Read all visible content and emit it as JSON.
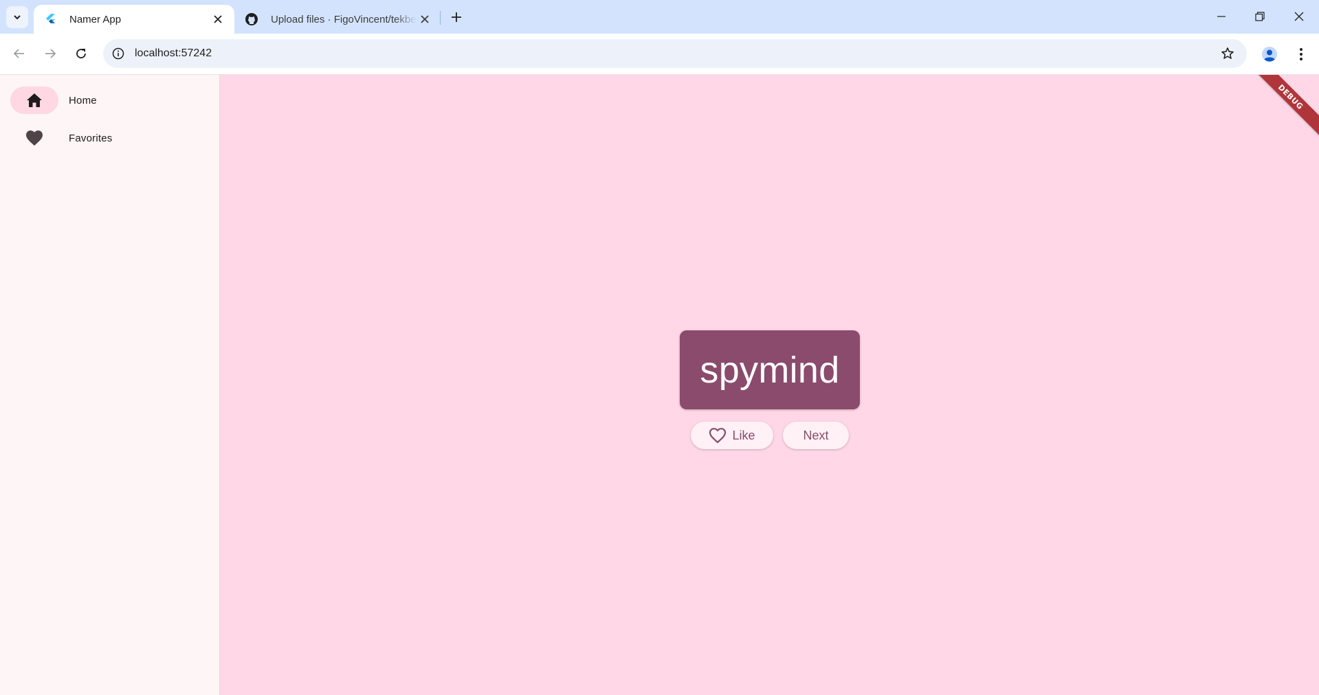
{
  "browser": {
    "tabs": [
      {
        "title": "Namer App",
        "icon": "flutter-icon",
        "active": true
      },
      {
        "title": "Upload files · FigoVincent/tekbe",
        "icon": "github-icon",
        "active": false
      }
    ],
    "address": "localhost:57242"
  },
  "app": {
    "nav": [
      {
        "label": "Home",
        "icon": "home-icon",
        "selected": true
      },
      {
        "label": "Favorites",
        "icon": "heart-icon",
        "selected": false
      }
    ],
    "word": "spymind",
    "like_label": "Like",
    "next_label": "Next",
    "debug_banner": "DEBUG"
  },
  "colors": {
    "background": "#ffd7e6",
    "card": "#8a4b6c",
    "rail": "#fdf5f6",
    "selected_indicator": "#ffd8e4",
    "debug_banner": "#b0353a"
  }
}
